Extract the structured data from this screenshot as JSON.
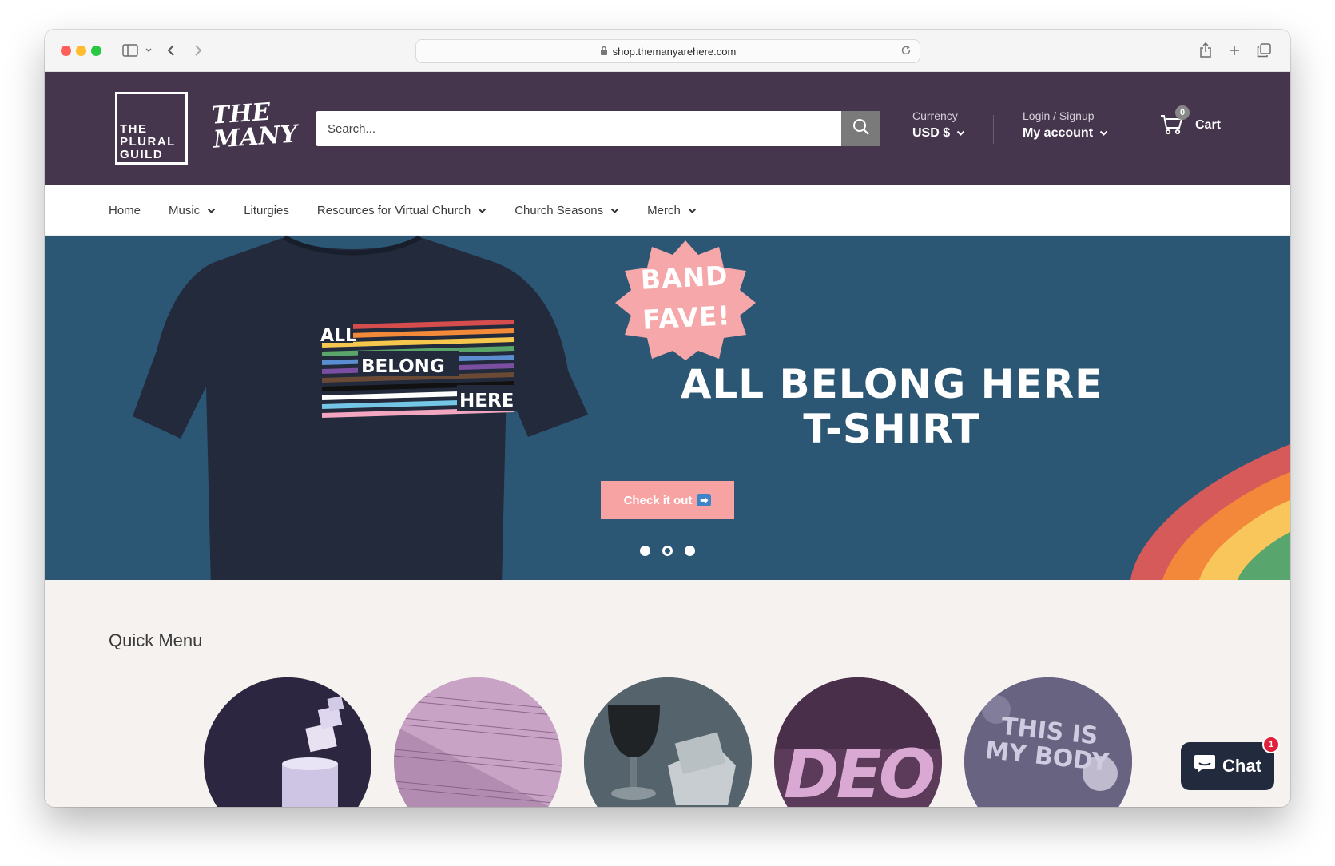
{
  "browser": {
    "url": "shop.themanyarehere.com"
  },
  "header": {
    "logo_plural_guild": "THE PLURAL GUILD",
    "logo_many": "THE MANY",
    "search_placeholder": "Search...",
    "currency_label": "Currency",
    "currency_value": "USD $",
    "login_label": "Login / Signup",
    "account_label": "My account",
    "cart_label": "Cart",
    "cart_count": "0",
    "brand_color": "#45364d"
  },
  "nav": {
    "items": [
      {
        "label": "Home",
        "dropdown": false
      },
      {
        "label": "Music",
        "dropdown": true
      },
      {
        "label": "Liturgies",
        "dropdown": false
      },
      {
        "label": "Resources for Virtual Church",
        "dropdown": true
      },
      {
        "label": "Church Seasons",
        "dropdown": true
      },
      {
        "label": "Merch",
        "dropdown": true
      }
    ]
  },
  "hero": {
    "badge_text": "BAND FAVE!",
    "title_line1": "ALL BELONG HERE",
    "title_line2": "T-SHIRT",
    "button_label": "Check it out",
    "shirt_text_all": "ALL",
    "shirt_text_belong": "BELONG",
    "shirt_text_here": "HERE",
    "slides_total": 3,
    "active_slide": 2,
    "background_color": "#2b5774",
    "button_color": "#f7a3a3"
  },
  "quick_menu": {
    "title": "Quick Menu",
    "items": [
      {
        "name": "candles",
        "text": ""
      },
      {
        "name": "sheet-music",
        "text": ""
      },
      {
        "name": "communion",
        "text": ""
      },
      {
        "name": "deo",
        "text": "DEO"
      },
      {
        "name": "this-is-my-body-shirt",
        "text": "THIS IS MY BODY"
      }
    ]
  },
  "chat": {
    "label": "Chat",
    "badge": "1"
  }
}
